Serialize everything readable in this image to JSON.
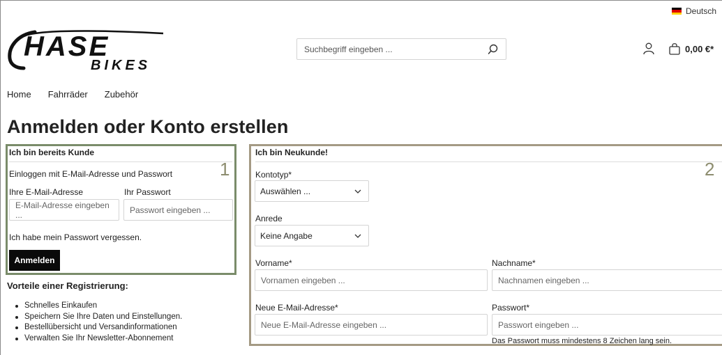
{
  "topbar": {
    "language": "Deutsch"
  },
  "header": {
    "logo_main": "HASE",
    "logo_sub": "BIKES",
    "search_placeholder": "Suchbegriff eingeben ...",
    "cart_total": "0,00 €*"
  },
  "nav": {
    "items": [
      "Home",
      "Fahrräder",
      "Zubehör"
    ]
  },
  "page_title": "Anmelden oder Konto erstellen",
  "login": {
    "heading": "Ich bin bereits Kunde",
    "number": "1",
    "subtitle": "Einloggen mit E-Mail-Adresse und Passwort",
    "email_label": "Ihre E-Mail-Adresse",
    "email_placeholder": "E-Mail-Adresse eingeben ...",
    "password_label": "Ihr Passwort",
    "password_placeholder": "Passwort eingeben ...",
    "forgot": "Ich habe mein Passwort vergessen.",
    "submit": "Anmelden"
  },
  "advantages": {
    "heading": "Vorteile einer Registrierung:",
    "items": [
      "Schnelles Einkaufen",
      "Speichern Sie Ihre Daten und Einstellungen.",
      "Bestellübersicht und Versandinformationen",
      "Verwalten Sie Ihr Newsletter-Abonnement"
    ]
  },
  "register": {
    "heading": "Ich bin Neukunde!",
    "number": "2",
    "account_type_label": "Kontotyp*",
    "account_type_value": "Auswählen ...",
    "salutation_label": "Anrede",
    "salutation_value": "Keine Angabe",
    "firstname_label": "Vorname*",
    "firstname_placeholder": "Vornamen eingeben ...",
    "lastname_label": "Nachname*",
    "lastname_placeholder": "Nachnamen eingeben ...",
    "email_label": "Neue E-Mail-Adresse*",
    "email_placeholder": "Neue E-Mail-Adresse eingeben ...",
    "password_label": "Passwort*",
    "password_placeholder": "Passwort eingeben ...",
    "password_hint": "Das Passwort muss mindestens 8 Zeichen lang sein."
  },
  "colors": {
    "login_box_border": "#7a8c6a",
    "register_box_border": "#a49a84",
    "button_bg": "#0a0a0a"
  }
}
